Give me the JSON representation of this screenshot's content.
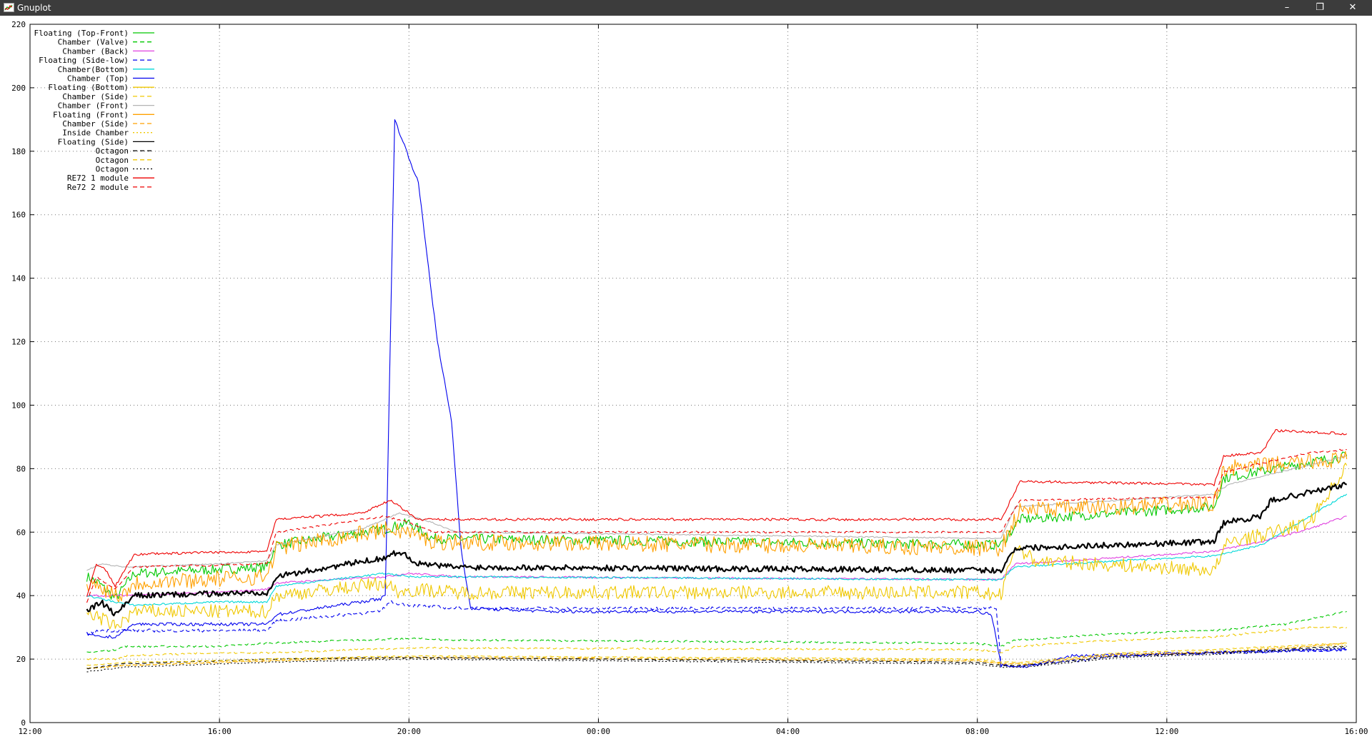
{
  "window": {
    "title": "Gnuplot",
    "min_glyph": "–",
    "max_glyph": "❐",
    "close_glyph": "✕"
  },
  "chart_data": {
    "type": "line",
    "title": "",
    "xlabel": "",
    "ylabel": "",
    "grid": true,
    "legend_position": "top-left",
    "ylim": [
      0,
      220
    ],
    "xlim": [
      "12:00",
      "16:00 (+1 day)"
    ],
    "x_ticks": [
      "12:00",
      "16:00",
      "20:00",
      "00:00",
      "04:00",
      "08:00",
      "12:00",
      "16:00"
    ],
    "y_ticks": [
      0,
      20,
      40,
      60,
      80,
      100,
      120,
      140,
      160,
      180,
      200,
      220
    ],
    "x_domain_hours": [
      0,
      28
    ],
    "series": [
      {
        "name": "Floating (Top-Front)",
        "color": "#00c800",
        "dash": "solid",
        "noise": 1.6,
        "points": [
          [
            1.2,
            46
          ],
          [
            1.45,
            44
          ],
          [
            1.8,
            39
          ],
          [
            2.2,
            47
          ],
          [
            5,
            49
          ],
          [
            5.2,
            56
          ],
          [
            7.5,
            61
          ],
          [
            8,
            63
          ],
          [
            8.5,
            58
          ],
          [
            20.5,
            56
          ],
          [
            20.9,
            64
          ],
          [
            25,
            68
          ],
          [
            25.2,
            77
          ],
          [
            27,
            82
          ],
          [
            27.8,
            84
          ]
        ]
      },
      {
        "name": "Chamber (Valve)",
        "color": "#00c800",
        "dash": "dash",
        "noise": 0.3,
        "points": [
          [
            1.2,
            22
          ],
          [
            1.8,
            23
          ],
          [
            2,
            24
          ],
          [
            4,
            24
          ],
          [
            5,
            25
          ],
          [
            8,
            26.5
          ],
          [
            9,
            26
          ],
          [
            20,
            25
          ],
          [
            20.5,
            24
          ],
          [
            20.8,
            26
          ],
          [
            23,
            28
          ],
          [
            25,
            29
          ],
          [
            26.5,
            31
          ],
          [
            27.8,
            35
          ]
        ]
      },
      {
        "name": "Chamber (Back)",
        "color": "#e040e0",
        "dash": "solid",
        "noise": 0.3,
        "points": [
          [
            1.2,
            40
          ],
          [
            1.8,
            40
          ],
          [
            4,
            41
          ],
          [
            5,
            42
          ],
          [
            5.2,
            44
          ],
          [
            7.5,
            46
          ],
          [
            8,
            47
          ],
          [
            9,
            46
          ],
          [
            20.5,
            45
          ],
          [
            20.8,
            50
          ],
          [
            23,
            52
          ],
          [
            25,
            54
          ],
          [
            26,
            57
          ],
          [
            27,
            61
          ],
          [
            27.8,
            65
          ]
        ]
      },
      {
        "name": "Floating (Side-low)",
        "color": "#0000ee",
        "dash": "dash",
        "noise": 0.5,
        "points": [
          [
            1.2,
            28
          ],
          [
            1.5,
            29
          ],
          [
            2,
            29
          ],
          [
            4,
            29
          ],
          [
            5,
            29
          ],
          [
            5.2,
            32
          ],
          [
            7.4,
            35
          ],
          [
            7.6,
            38
          ],
          [
            8,
            37
          ],
          [
            9,
            36
          ],
          [
            20.4,
            36
          ],
          [
            20.5,
            18
          ],
          [
            21,
            18
          ],
          [
            23,
            21
          ],
          [
            25,
            22
          ],
          [
            27.8,
            23
          ]
        ]
      },
      {
        "name": "Chamber(Bottom)",
        "color": "#00d8d8",
        "dash": "solid",
        "noise": 0.3,
        "points": [
          [
            1.2,
            40
          ],
          [
            1.8,
            38
          ],
          [
            2.2,
            37
          ],
          [
            4,
            38
          ],
          [
            5,
            38
          ],
          [
            5.2,
            43
          ],
          [
            7.5,
            47
          ],
          [
            8,
            46
          ],
          [
            20.5,
            45
          ],
          [
            20.8,
            49
          ],
          [
            23,
            51
          ],
          [
            25,
            52.5
          ],
          [
            26,
            56
          ],
          [
            27.8,
            72
          ]
        ]
      },
      {
        "name": "Chamber (Top)",
        "color": "#0000ee",
        "dash": "solid",
        "noise": 0.5,
        "points": [
          [
            1.2,
            28
          ],
          [
            1.4,
            27
          ],
          [
            1.8,
            27
          ],
          [
            2.2,
            31
          ],
          [
            5,
            31
          ],
          [
            5.2,
            34
          ],
          [
            7.4,
            39
          ],
          [
            7.5,
            40
          ],
          [
            7.52,
            55
          ],
          [
            7.7,
            190
          ],
          [
            8.2,
            170
          ],
          [
            8.6,
            120
          ],
          [
            8.9,
            95
          ],
          [
            9.1,
            55
          ],
          [
            9.3,
            36
          ],
          [
            11,
            35
          ],
          [
            20,
            35
          ],
          [
            20.3,
            34
          ],
          [
            20.5,
            18
          ],
          [
            21,
            17.5
          ],
          [
            22,
            21
          ],
          [
            25,
            22
          ],
          [
            27.8,
            23
          ]
        ]
      },
      {
        "name": "Floating (Bottom)",
        "color": "#f0c800",
        "dash": "solid",
        "noise": 2.2,
        "points": [
          [
            1.2,
            35
          ],
          [
            1.6,
            32
          ],
          [
            1.8,
            30
          ],
          [
            2.2,
            35
          ],
          [
            4,
            35
          ],
          [
            5,
            35
          ],
          [
            5.2,
            40
          ],
          [
            7.5,
            44
          ],
          [
            7.8,
            41
          ],
          [
            8.2,
            42
          ],
          [
            9,
            41
          ],
          [
            20,
            41
          ],
          [
            20.5,
            40
          ],
          [
            20.8,
            56
          ],
          [
            21.2,
            51
          ],
          [
            25,
            48
          ],
          [
            25.3,
            57
          ],
          [
            26,
            59
          ],
          [
            27,
            63
          ],
          [
            27.8,
            81
          ]
        ]
      },
      {
        "name": "Chamber (Side)",
        "color": "#f0c800",
        "dash": "dash",
        "noise": 0.3,
        "points": [
          [
            1.2,
            20
          ],
          [
            1.8,
            20
          ],
          [
            2,
            21
          ],
          [
            4,
            22
          ],
          [
            5,
            22
          ],
          [
            8,
            23.5
          ],
          [
            20,
            23
          ],
          [
            20.5,
            22
          ],
          [
            20.8,
            24
          ],
          [
            23,
            26
          ],
          [
            25,
            27
          ],
          [
            27,
            30
          ],
          [
            27.8,
            30
          ]
        ]
      },
      {
        "name": "Chamber (Front)",
        "color": "#b4b4b4",
        "dash": "solid",
        "noise": 0.2,
        "points": [
          [
            1.2,
            48
          ],
          [
            1.5,
            50
          ],
          [
            2,
            49
          ],
          [
            4,
            50
          ],
          [
            5,
            51
          ],
          [
            5.2,
            56
          ],
          [
            7,
            61
          ],
          [
            7.8,
            66
          ],
          [
            8.5,
            63
          ],
          [
            9,
            60
          ],
          [
            20.5,
            58
          ],
          [
            20.8,
            68
          ],
          [
            23,
            70
          ],
          [
            25,
            72
          ],
          [
            25.3,
            75
          ],
          [
            27.8,
            84
          ]
        ]
      },
      {
        "name": "Floating (Front)",
        "color": "#ffa000",
        "dash": "solid",
        "noise": 2.6,
        "points": [
          [
            1.2,
            44
          ],
          [
            1.6,
            42
          ],
          [
            1.9,
            40
          ],
          [
            2.2,
            44
          ],
          [
            5,
            46
          ],
          [
            5.2,
            55
          ],
          [
            7.6,
            61
          ],
          [
            8,
            60
          ],
          [
            8.5,
            57
          ],
          [
            20.5,
            55
          ],
          [
            20.9,
            67
          ],
          [
            23,
            68
          ],
          [
            25,
            69
          ],
          [
            25.2,
            80
          ],
          [
            27.8,
            83
          ]
        ]
      },
      {
        "name": "Chamber (Side)",
        "color": "#ffa000",
        "dash": "dash",
        "noise": 0.2,
        "points": [
          [
            1.2,
            17
          ],
          [
            2,
            18
          ],
          [
            4,
            19
          ],
          [
            5,
            19.5
          ],
          [
            8,
            20.5
          ],
          [
            20,
            19.5
          ],
          [
            20.5,
            18.5
          ],
          [
            21,
            18.5
          ],
          [
            23,
            21.5
          ],
          [
            25,
            22
          ],
          [
            27,
            24
          ],
          [
            27.8,
            25
          ]
        ]
      },
      {
        "name": "Inside Chamber",
        "color": "#f0c800",
        "dash": "dot",
        "noise": 0.2,
        "points": [
          [
            1.2,
            17
          ],
          [
            2,
            18
          ],
          [
            4,
            19
          ],
          [
            5,
            19.5
          ],
          [
            8,
            20.5
          ],
          [
            20,
            19.5
          ],
          [
            20.5,
            18.5
          ],
          [
            21,
            18.5
          ],
          [
            23,
            21.5
          ],
          [
            25,
            22.5
          ],
          [
            27,
            24
          ],
          [
            27.8,
            24.5
          ]
        ]
      },
      {
        "name": "Floating (Side)",
        "color": "#000000",
        "dash": "solid",
        "noise": 0.9,
        "width": 2.2,
        "points": [
          [
            1.2,
            35
          ],
          [
            1.5,
            38
          ],
          [
            1.8,
            34
          ],
          [
            2.2,
            40
          ],
          [
            5,
            41
          ],
          [
            5.2,
            46
          ],
          [
            7.5,
            52
          ],
          [
            7.8,
            54
          ],
          [
            8.2,
            50
          ],
          [
            9,
            49
          ],
          [
            20,
            48
          ],
          [
            20.5,
            48
          ],
          [
            20.8,
            55
          ],
          [
            23,
            56
          ],
          [
            25,
            57
          ],
          [
            25.2,
            63
          ],
          [
            26,
            65
          ],
          [
            26.2,
            70
          ],
          [
            27.8,
            75
          ]
        ]
      },
      {
        "name": "Octagon",
        "color": "#000000",
        "dash": "dash",
        "noise": 0.15,
        "points": [
          [
            1.2,
            17
          ],
          [
            2,
            18.5
          ],
          [
            4,
            19.5
          ],
          [
            5,
            20
          ],
          [
            8,
            20.5
          ],
          [
            20,
            19
          ],
          [
            20.5,
            18
          ],
          [
            21,
            18
          ],
          [
            23,
            21
          ],
          [
            25,
            22
          ],
          [
            27,
            23.5
          ],
          [
            27.8,
            24
          ]
        ]
      },
      {
        "name": "Octagon",
        "color": "#f0c800",
        "dash": "dash",
        "noise": 0.15,
        "points": [
          [
            1.2,
            18
          ],
          [
            2,
            19
          ],
          [
            4,
            19.5
          ],
          [
            5,
            20
          ],
          [
            8,
            21
          ],
          [
            20,
            20
          ],
          [
            20.5,
            19
          ],
          [
            21,
            19
          ],
          [
            23,
            22
          ],
          [
            25,
            23
          ],
          [
            27,
            24.5
          ],
          [
            27.8,
            25
          ]
        ]
      },
      {
        "name": "Octagon",
        "color": "#000000",
        "dash": "dot",
        "noise": 0.15,
        "points": [
          [
            1.2,
            16
          ],
          [
            2,
            17.5
          ],
          [
            4,
            18.5
          ],
          [
            5,
            19
          ],
          [
            8,
            20
          ],
          [
            20,
            18.5
          ],
          [
            20.5,
            17.5
          ],
          [
            21,
            17.5
          ],
          [
            23,
            20.5
          ],
          [
            25,
            21.5
          ],
          [
            27,
            23
          ],
          [
            27.8,
            23.5
          ]
        ]
      },
      {
        "name": "RE72 1 module",
        "color": "#ee0000",
        "dash": "solid",
        "noise": 0.4,
        "points": [
          [
            1.2,
            40
          ],
          [
            1.4,
            50
          ],
          [
            1.6,
            48
          ],
          [
            1.8,
            43
          ],
          [
            2.2,
            53
          ],
          [
            5,
            54
          ],
          [
            5.2,
            64
          ],
          [
            7,
            66
          ],
          [
            7.6,
            70
          ],
          [
            8.2,
            64
          ],
          [
            20.5,
            64
          ],
          [
            20.9,
            76
          ],
          [
            25,
            75
          ],
          [
            25.2,
            84
          ],
          [
            26,
            85
          ],
          [
            26.3,
            92
          ],
          [
            27.8,
            91
          ]
        ]
      },
      {
        "name": "Re72 2 module",
        "color": "#ee0000",
        "dash": "dash",
        "noise": 0.3,
        "points": [
          [
            1.2,
            38
          ],
          [
            1.4,
            46
          ],
          [
            1.8,
            42
          ],
          [
            2.2,
            49
          ],
          [
            5,
            50
          ],
          [
            5.2,
            60
          ],
          [
            7.5,
            65
          ],
          [
            8,
            63
          ],
          [
            8.5,
            60
          ],
          [
            20.5,
            60
          ],
          [
            20.9,
            70
          ],
          [
            25,
            71
          ],
          [
            25.2,
            79
          ],
          [
            27,
            85
          ],
          [
            27.8,
            86
          ]
        ]
      }
    ]
  }
}
